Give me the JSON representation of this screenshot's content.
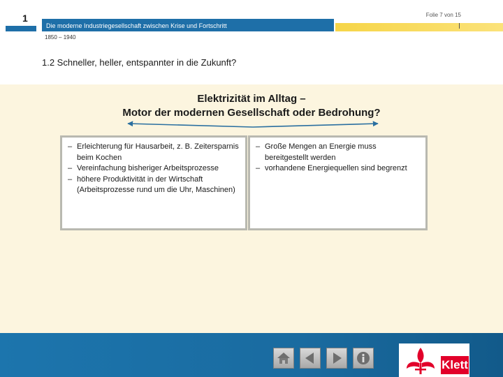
{
  "header": {
    "chapter_number": "1",
    "title": "Die moderne Industriegesellschaft zwischen Krise und Fortschritt",
    "slide_counter": "Folie 7 von 15",
    "date_range": "1850 – 1940",
    "section_title": "1.2  Schneller, heller, entspannter in die Zukunft?"
  },
  "main": {
    "heading_line1": "Elektrizität im Alltag –",
    "heading_line2": "Motor der modernen Gesellschaft oder Bedrohung?",
    "left_box": {
      "items": [
        "Erleichterung für Hausarbeit, z. B. Zeitersparnis beim Kochen",
        "Vereinfachung bisheriger Arbeitsprozesse",
        "höhere Produktivität in der Wirtschaft (Arbeitsprozesse rund um die Uhr, Maschinen)"
      ]
    },
    "right_box": {
      "items": [
        "Große Mengen an Energie muss bereitgestellt werden",
        "vorhandene Energiequellen sind begrenzt"
      ]
    }
  },
  "footer": {
    "nav_icons": [
      "home-icon",
      "previous-icon",
      "next-icon",
      "info-icon"
    ],
    "logo_text": "Klett"
  },
  "colors": {
    "primary_blue": "#1e6fa8",
    "accent_yellow": "#f6d548",
    "content_bg": "#fcf5df",
    "arrow_blue": "#2a6fa0",
    "logo_red": "#e2002a"
  }
}
